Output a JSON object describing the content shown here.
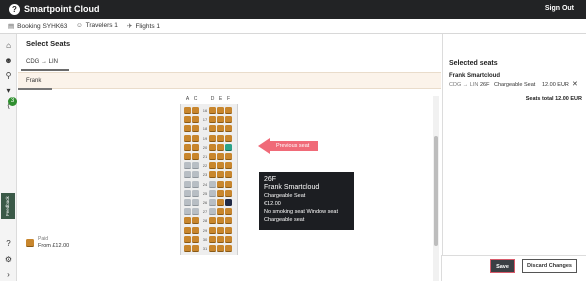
{
  "app": {
    "title": "Smartpoint Cloud",
    "sign_out": "Sign Out",
    "logo_glyph": "?"
  },
  "tabs": [
    {
      "label": "Booking SYHK63",
      "icon": "document-icon"
    },
    {
      "label": "Travelers 1",
      "icon": "users-icon"
    },
    {
      "label": "Flights 1",
      "icon": "plane-icon"
    }
  ],
  "sidenav": {
    "items": [
      "home-icon",
      "user-add-icon",
      "search-icon",
      "cart-icon",
      "share-icon",
      "help-icon",
      "settings-icon",
      "terminal-icon"
    ],
    "badge": "3",
    "feedback": "Feedback"
  },
  "main": {
    "title": "Select Seats",
    "route_tab": "CDG → LIN",
    "passenger": "Frank"
  },
  "seatmap": {
    "columns": [
      "A",
      "C",
      "D",
      "E",
      "F"
    ],
    "rows": [
      "16",
      "17",
      "18",
      "19",
      "20",
      "21",
      "22",
      "23",
      "24",
      "25",
      "26",
      "27",
      "28",
      "29",
      "30",
      "31"
    ]
  },
  "callout": {
    "label": "Previous seat"
  },
  "tooltip": {
    "seat": "26F",
    "name": "Frank Smartcloud",
    "type": "Chargeable Seat",
    "price": "€12.00",
    "features": "No smoking seat Window seat",
    "category": "Chargeable seat"
  },
  "legend": {
    "title": "Paid",
    "price": "From £12.00"
  },
  "selected": {
    "title": "Selected seats",
    "name": "Frank Smartcloud",
    "route": "CDG → LIN",
    "seat": "26F",
    "type": "Chargeable Seat",
    "price": "12.00 EUR",
    "remove": "✕",
    "total": "Seats total 12.00 EUR"
  },
  "buttons": {
    "save": "Save",
    "discard": "Discard Changes"
  },
  "colors": {
    "paid_seat": "#c8862d",
    "previous_seat": "#2ba48a",
    "accent_callout": "#f06a78",
    "topbar": "#222325"
  }
}
